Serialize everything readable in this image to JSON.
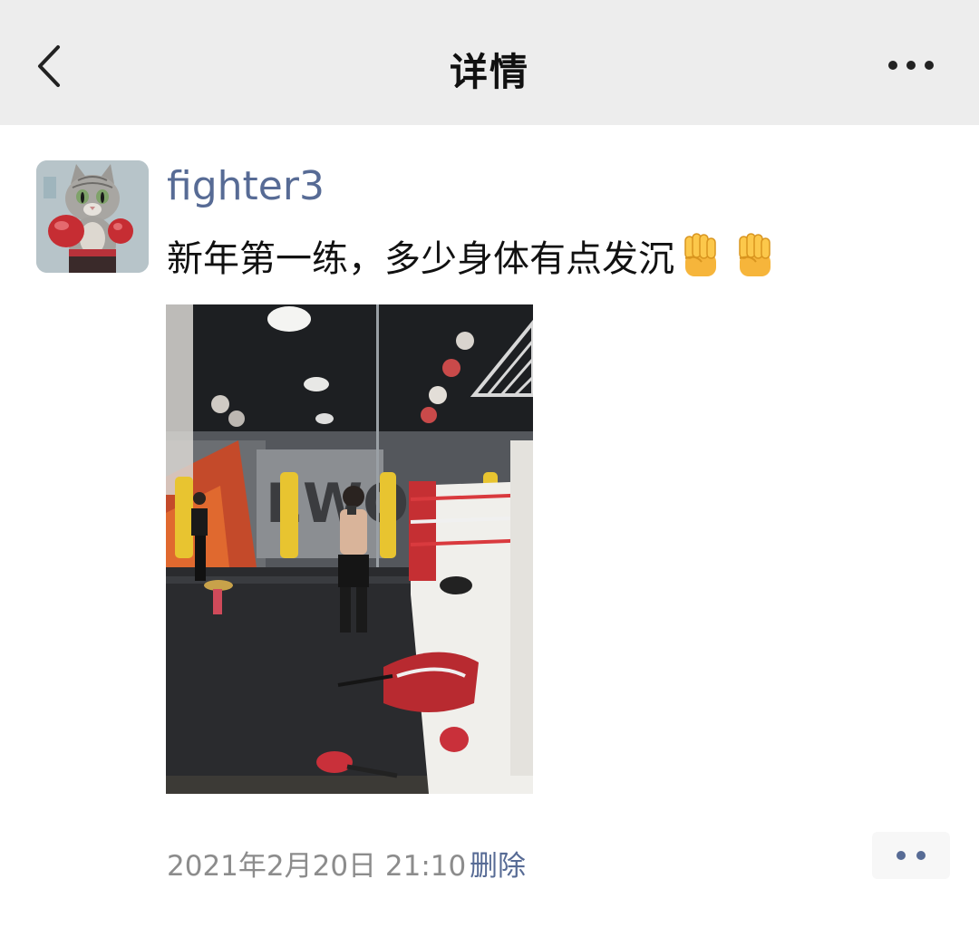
{
  "header": {
    "title": "详情",
    "back_icon": "chevron-left-icon",
    "more_icon": "more-horizontal-icon"
  },
  "post": {
    "avatar_icon": "cat-boxer-avatar",
    "username": "fighter3",
    "text": "新年第一练，多少身体有点发沉",
    "emojis": [
      "✊",
      "✊"
    ],
    "photo": "gym-mirror-selfie-photo",
    "timestamp": "2021年2月20日 21:10",
    "delete_label": "删除",
    "comment_icon": "comment-dots-icon"
  },
  "colors": {
    "topbar_bg": "#ededed",
    "link": "#576b95",
    "meta_text": "#8c8c8c",
    "body_text": "#111111"
  }
}
